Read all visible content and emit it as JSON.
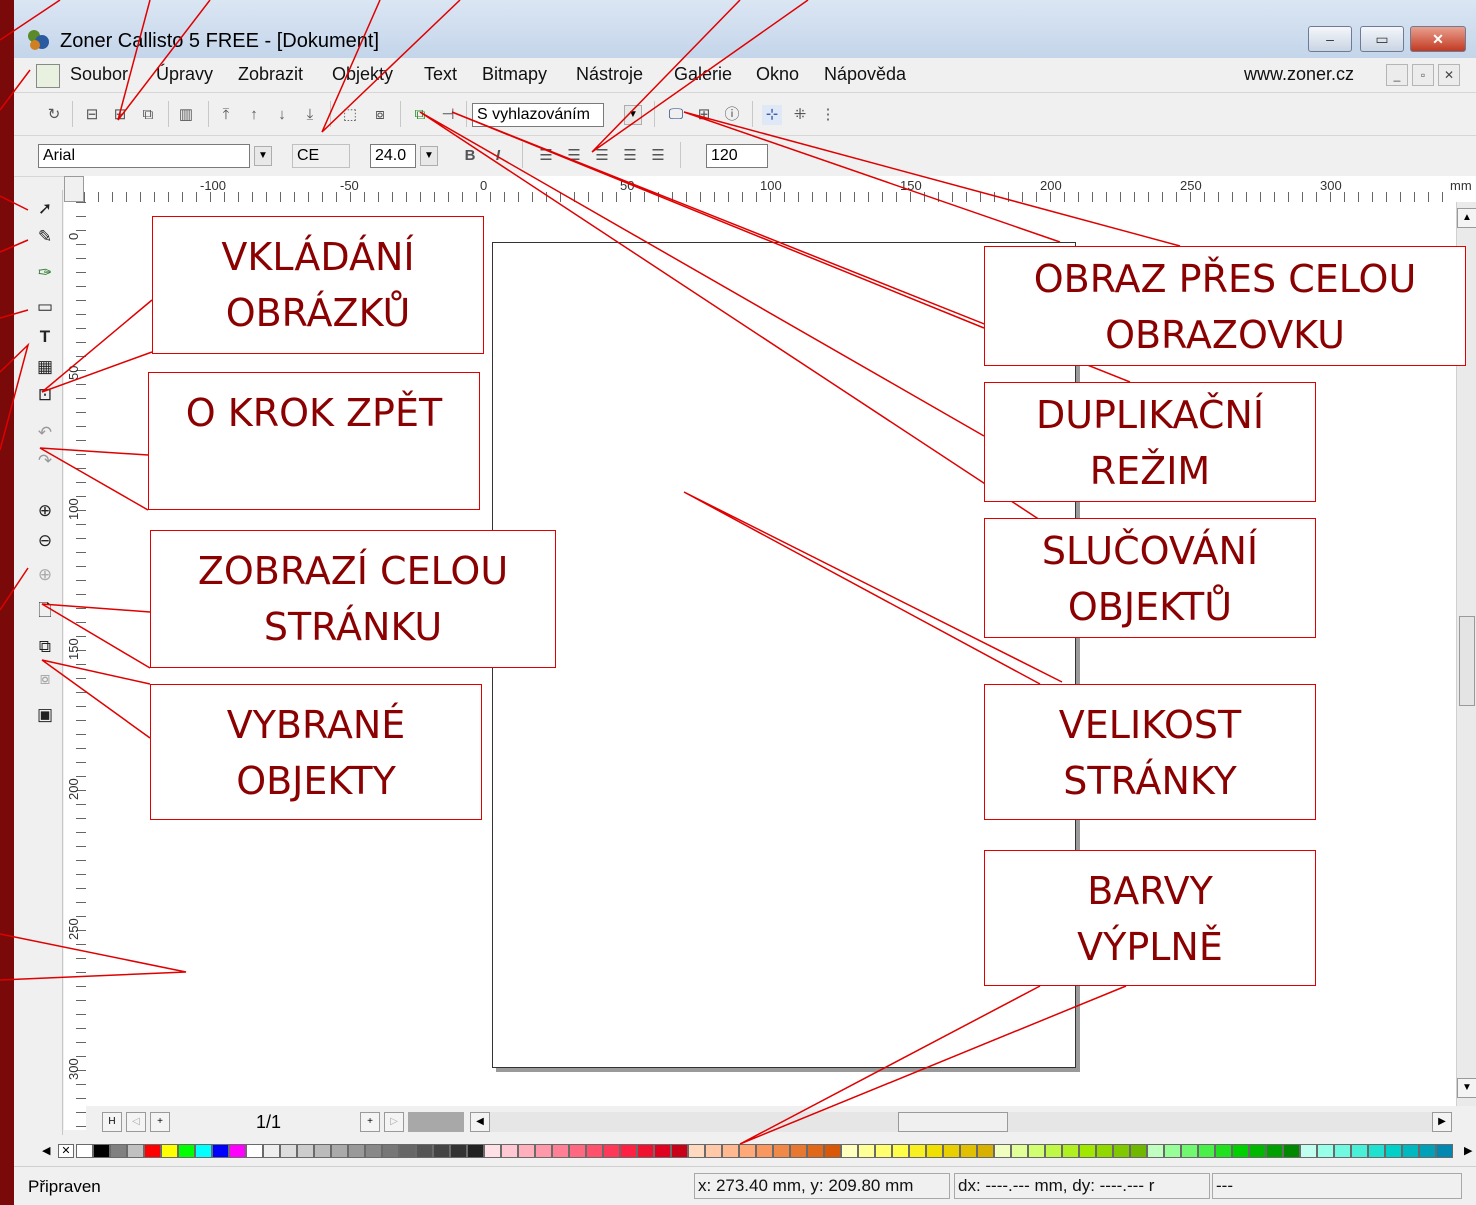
{
  "window": {
    "title": "Zoner Callisto 5 FREE - [Dokument]",
    "minimize": "–",
    "maximize": "▭",
    "close": "✕"
  },
  "menu": {
    "items": [
      "Soubor",
      "Úpravy",
      "Zobrazit",
      "Objekty",
      "Text",
      "Bitmapy",
      "Nástroje",
      "Galerie",
      "Okno",
      "Nápověda"
    ],
    "website": "www.zoner.cz"
  },
  "toolbar1": {
    "render_mode": "S vyhlazováním"
  },
  "toolbar2": {
    "font": "Arial",
    "charset": "CE",
    "size": "24.0",
    "spacing": "120"
  },
  "ruler": {
    "unit": "mm",
    "h_labels": [
      "-100",
      "-50",
      "0",
      "50",
      "100",
      "150",
      "200",
      "250",
      "300"
    ],
    "v_labels": [
      "0",
      "50",
      "100",
      "150",
      "200",
      "250",
      "300"
    ]
  },
  "navigator": {
    "page_indicator": "1/1"
  },
  "status": {
    "state": "Připraven",
    "coords": "x: 273.40 mm, y: 209.80 mm",
    "delta": "dx: ----.--- mm, dy: ----.--- r",
    "extra": "---"
  },
  "palette": {
    "colors": [
      "#ffffff",
      "#000000",
      "#808080",
      "#c0c0c0",
      "#ff0000",
      "#ffff00",
      "#00ff00",
      "#00ffff",
      "#0000ff",
      "#ff00ff",
      "#ffffff",
      "#eeeeee",
      "#dddddd",
      "#cccccc",
      "#bbbbbb",
      "#aaaaaa",
      "#999999",
      "#888888",
      "#777777",
      "#666666",
      "#555555",
      "#444444",
      "#333333",
      "#222222",
      "#ffe0e6",
      "#ffc8d2",
      "#ffb0bc",
      "#ff98a8",
      "#ff8094",
      "#ff6880",
      "#ff506c",
      "#ff3858",
      "#ff2044",
      "#f01030",
      "#e00020",
      "#c80018",
      "#ffd8c0",
      "#ffc8a8",
      "#ffb890",
      "#ffa878",
      "#f89860",
      "#f08848",
      "#e87830",
      "#e06818",
      "#d85808",
      "#ffffc0",
      "#ffff98",
      "#ffff70",
      "#ffff48",
      "#f8f020",
      "#f0e000",
      "#e8d000",
      "#e0c000",
      "#d8b000",
      "#f0ffc0",
      "#e0ff98",
      "#d0ff70",
      "#c0f848",
      "#b0f020",
      "#a0e800",
      "#90d800",
      "#80c800",
      "#70b800",
      "#c0ffc0",
      "#98ff98",
      "#70f870",
      "#48f048",
      "#20e020",
      "#00d000",
      "#00b800",
      "#00a000",
      "#008800",
      "#c0fff0",
      "#98ffe8",
      "#70f8e0",
      "#48f0d8",
      "#20e0d0",
      "#00d0c8",
      "#00b8c0",
      "#00a0b8",
      "#0088b0"
    ]
  },
  "callouts": {
    "insert_images": [
      "VKLÁDÁNÍ",
      "OBRÁZKŮ"
    ],
    "undo": [
      "O KROK ZPĚT"
    ],
    "show_whole_page": [
      "ZOBRAZÍ CELOU",
      "STRÁNKU"
    ],
    "selected_objects": [
      "VYBRANÉ",
      "OBJEKTY"
    ],
    "fullscreen": [
      "OBRAZ PŘES CELOU",
      "OBRAZOVKU"
    ],
    "duplicate_mode": [
      "DUPLIKAČNÍ",
      "REŽIM"
    ],
    "merge_objects": [
      "SLUČOVÁNÍ",
      "OBJEKTŮ"
    ],
    "page_size": [
      "VELIKOST",
      "STRÁNKY"
    ],
    "fill_colors": [
      "BARVY",
      "VÝPLNĚ"
    ]
  },
  "colors": {
    "callout_border": "#e00000",
    "callout_text": "#8b0000",
    "frame": "#7a0a0a"
  }
}
